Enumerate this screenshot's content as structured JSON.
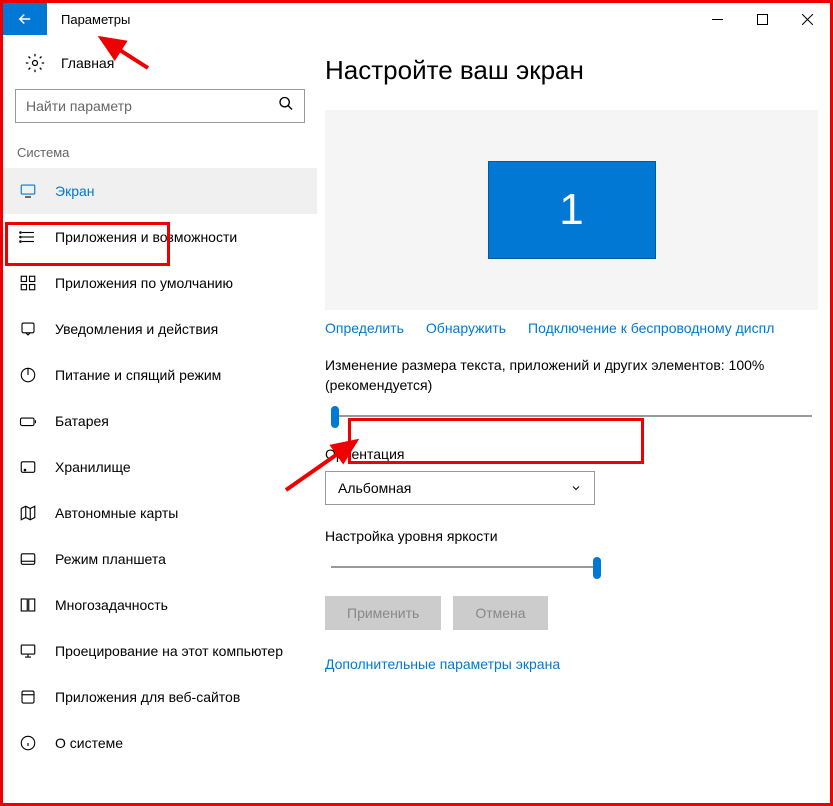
{
  "titlebar": {
    "title": "Параметры"
  },
  "sidebar": {
    "home": "Главная",
    "search_placeholder": "Найти параметр",
    "section": "Система",
    "items": [
      {
        "label": "Экран",
        "icon": "display",
        "active": true
      },
      {
        "label": "Приложения и возможности",
        "icon": "apps",
        "active": false
      },
      {
        "label": "Приложения по умолчанию",
        "icon": "default-apps",
        "active": false
      },
      {
        "label": "Уведомления и действия",
        "icon": "notifications",
        "active": false
      },
      {
        "label": "Питание и спящий режим",
        "icon": "power",
        "active": false
      },
      {
        "label": "Батарея",
        "icon": "battery",
        "active": false
      },
      {
        "label": "Хранилище",
        "icon": "storage",
        "active": false
      },
      {
        "label": "Автономные карты",
        "icon": "maps",
        "active": false
      },
      {
        "label": "Режим планшета",
        "icon": "tablet",
        "active": false
      },
      {
        "label": "Многозадачность",
        "icon": "multitask",
        "active": false
      },
      {
        "label": "Проецирование на этот компьютер",
        "icon": "project",
        "active": false
      },
      {
        "label": "Приложения для веб-сайтов",
        "icon": "web-apps",
        "active": false
      },
      {
        "label": "О системе",
        "icon": "about",
        "active": false
      }
    ]
  },
  "content": {
    "heading": "Настройте ваш экран",
    "monitor_number": "1",
    "link_identify": "Определить",
    "link_detect": "Обнаружить",
    "link_wireless": "Подключение к беспроводному диспл",
    "scale_label": "Изменение размера текста, приложений и других элементов: 100% (рекомендуется)",
    "orientation_label": "Ориентация",
    "orientation_value": "Альбомная",
    "brightness_label": "Настройка уровня яркости",
    "btn_apply": "Применить",
    "btn_cancel": "Отмена",
    "link_advanced": "Дополнительные параметры экрана"
  }
}
